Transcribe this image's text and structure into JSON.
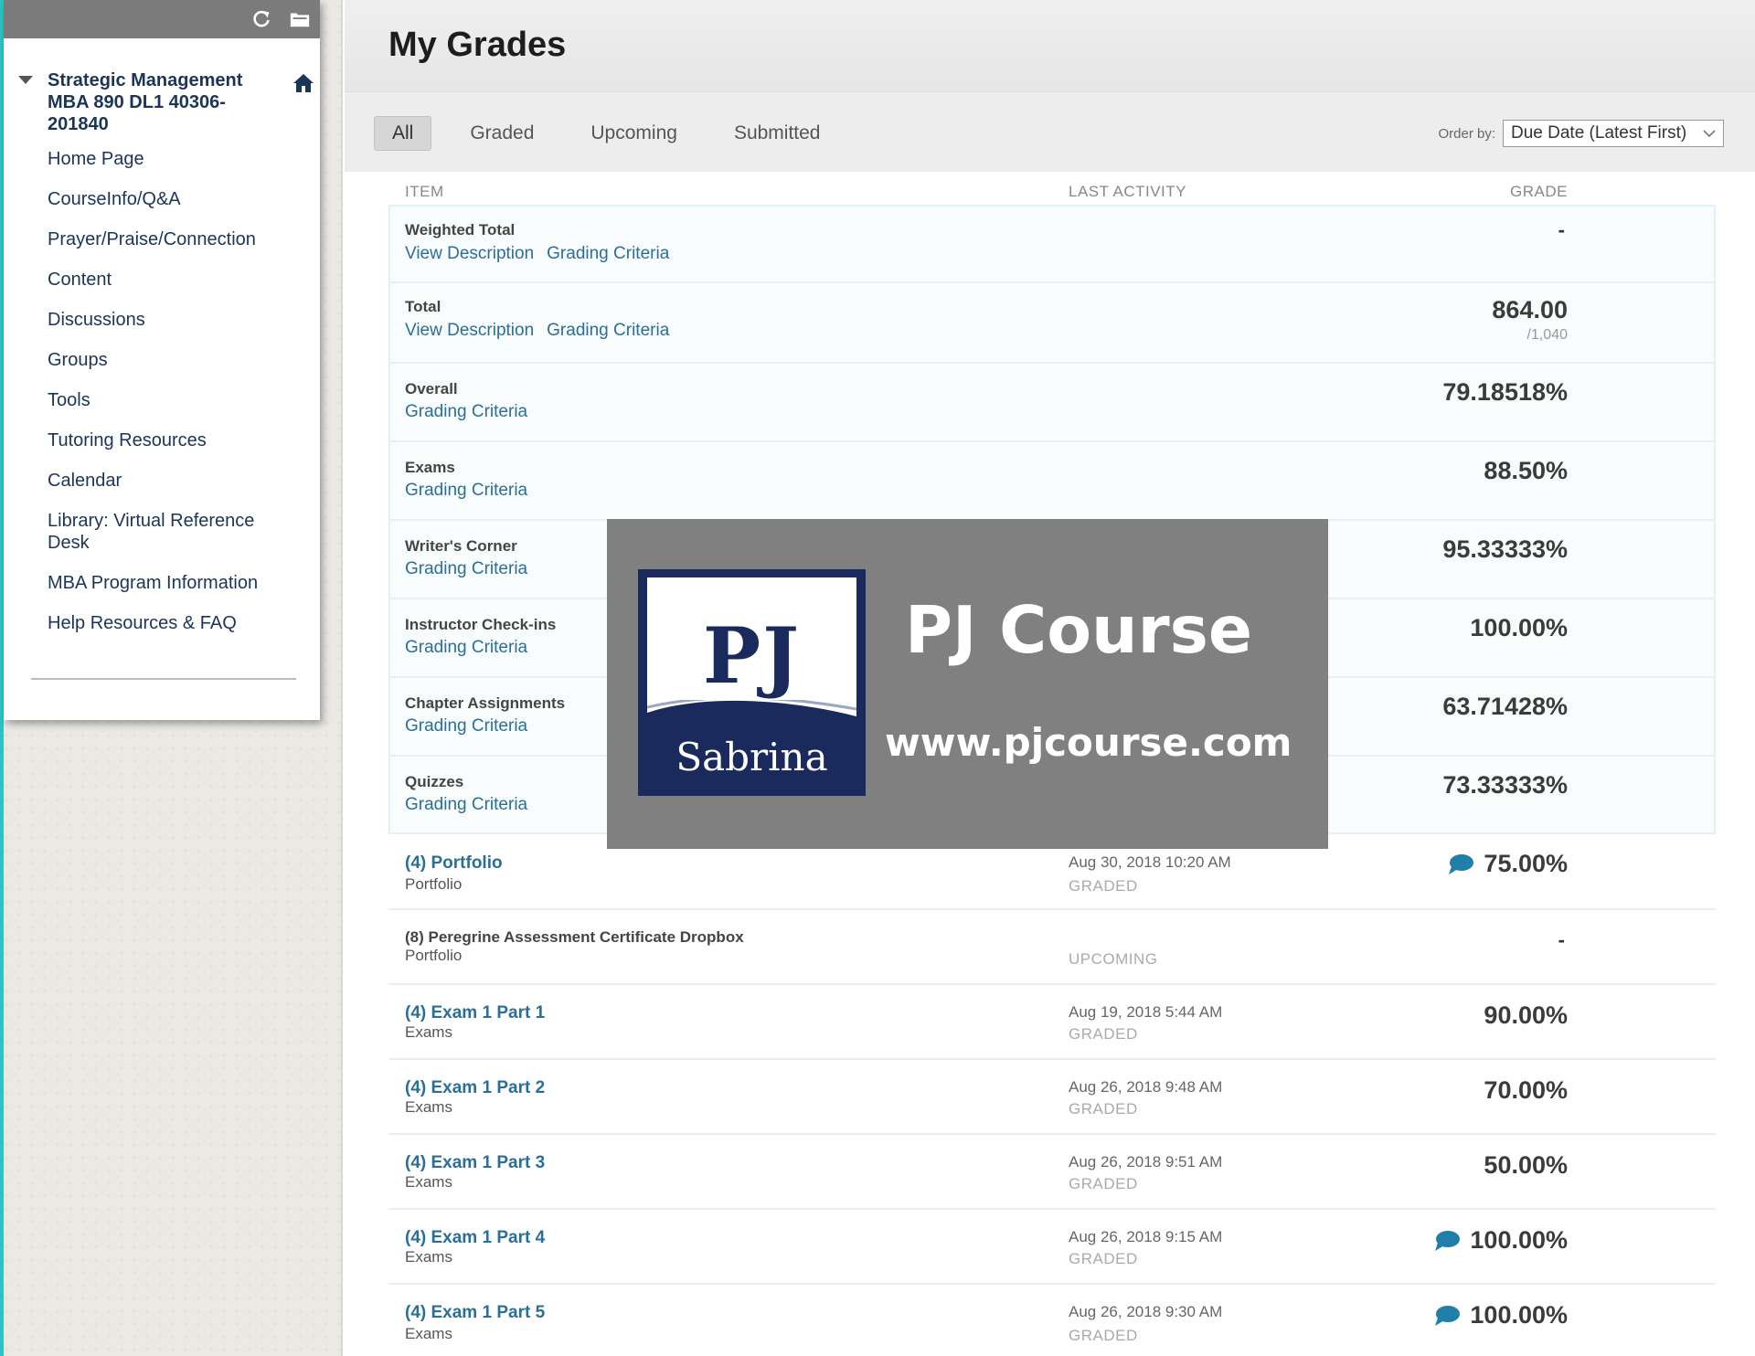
{
  "sidebar": {
    "course_title": "Strategic Management MBA 890 DL1 40306-201840",
    "items": [
      "Home Page",
      "CourseInfo/Q&A",
      "Prayer/Praise/Connection",
      "Content",
      "Discussions",
      "Groups",
      "Tools",
      "Tutoring Resources",
      "Calendar",
      "Library: Virtual Reference Desk",
      "MBA Program Information",
      "Help Resources & FAQ"
    ]
  },
  "page": {
    "title": "My Grades"
  },
  "filters": {
    "tabs": [
      "All",
      "Graded",
      "Upcoming",
      "Submitted"
    ],
    "active": "All",
    "order_label": "Order by:",
    "order_value": "Due Date (Latest First)"
  },
  "columns": {
    "item": "ITEM",
    "last_activity": "LAST ACTIVITY",
    "grade": "GRADE"
  },
  "links": {
    "view_description": "View Description",
    "grading_criteria": "Grading Criteria"
  },
  "summary_rows": [
    {
      "name": "Weighted Total",
      "grade": "-"
    },
    {
      "name": "Total",
      "grade": "864.00",
      "possible": "/1,040"
    },
    {
      "name": "Overall",
      "grade": "79.18518%"
    },
    {
      "name": "Exams",
      "grade": "88.50%"
    },
    {
      "name": "Writer's Corner",
      "grade": "95.33333%"
    },
    {
      "name": "Instructor Check-ins",
      "grade": "100.00%"
    },
    {
      "name": "Chapter Assignments",
      "grade": "63.71428%"
    },
    {
      "name": "Quizzes",
      "grade": "73.33333%"
    }
  ],
  "item_rows": [
    {
      "name": "(4) Portfolio",
      "category": "Portfolio",
      "date": "Aug 30, 2018 10:20 AM",
      "status": "GRADED",
      "grade": "75.00%",
      "comment": true
    },
    {
      "name": "(8) Peregrine Assessment Certificate Dropbox",
      "category": "Portfolio",
      "date": "",
      "status": "UPCOMING",
      "grade": "-",
      "comment": false
    },
    {
      "name": "(4) Exam 1 Part 1",
      "category": "Exams",
      "date": "Aug 19, 2018 5:44 AM",
      "status": "GRADED",
      "grade": "90.00%",
      "comment": false
    },
    {
      "name": "(4) Exam 1 Part 2",
      "category": "Exams",
      "date": "Aug 26, 2018 9:48 AM",
      "status": "GRADED",
      "grade": "70.00%",
      "comment": false
    },
    {
      "name": "(4) Exam 1 Part 3",
      "category": "Exams",
      "date": "Aug 26, 2018 9:51 AM",
      "status": "GRADED",
      "grade": "50.00%",
      "comment": false
    },
    {
      "name": "(4) Exam 1 Part 4",
      "category": "Exams",
      "date": "Aug 26, 2018 9:15 AM",
      "status": "GRADED",
      "grade": "100.00%",
      "comment": true
    },
    {
      "name": "(4) Exam 1 Part 5",
      "category": "Exams",
      "date": "Aug 26, 2018 9:30 AM",
      "status": "GRADED",
      "grade": "100.00%",
      "comment": true
    }
  ],
  "watermark": {
    "logo_top": "PJ",
    "logo_bottom": "Sabrina",
    "title": "PJ Course",
    "url": "www.pjcourse.com"
  },
  "colors": {
    "link": "#2a6f97",
    "accent": "#2cc4c2",
    "menu_text": "#1b3559",
    "comment_icon": "#1f7fa8"
  },
  "icons": [
    "refresh-icon",
    "folder-icon",
    "caret-down-icon",
    "home-icon",
    "chevron-down-icon",
    "comment-icon"
  ]
}
